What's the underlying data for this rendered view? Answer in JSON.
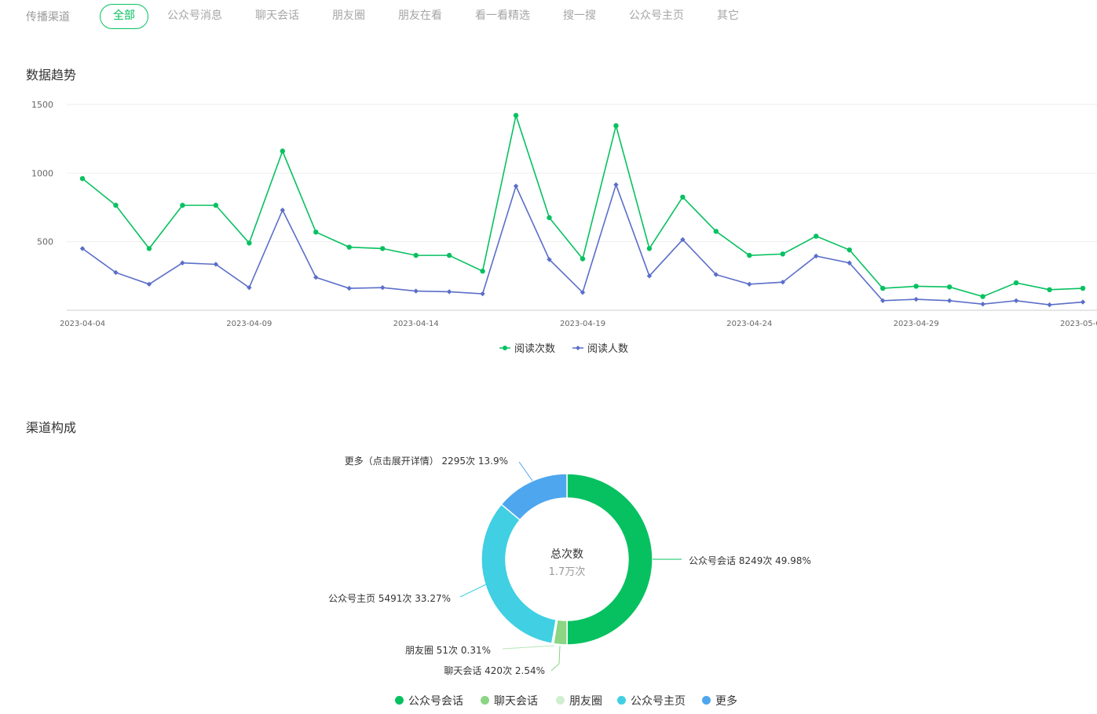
{
  "filter": {
    "label": "传播渠道",
    "tabs": [
      {
        "label": "全部",
        "active": true
      },
      {
        "label": "公众号消息",
        "active": false
      },
      {
        "label": "聊天会话",
        "active": false
      },
      {
        "label": "朋友圈",
        "active": false
      },
      {
        "label": "朋友在看",
        "active": false
      },
      {
        "label": "看一看精选",
        "active": false
      },
      {
        "label": "搜一搜",
        "active": false
      },
      {
        "label": "公众号主页",
        "active": false
      },
      {
        "label": "其它",
        "active": false
      }
    ]
  },
  "trend": {
    "title": "数据趋势"
  },
  "composition": {
    "title": "渠道构成"
  },
  "colors": {
    "accent": "#07c160",
    "reads": "#07c160",
    "readers": "#5b6ec9",
    "gongzhonghao_chat": "#07c160",
    "chat": "#8bd584",
    "moments": "#cfefcf",
    "homepage": "#40cfe3",
    "more": "#4da6ee"
  },
  "chart_data": [
    {
      "type": "line",
      "x": [
        "2023-04-04",
        "2023-04-05",
        "2023-04-06",
        "2023-04-07",
        "2023-04-08",
        "2023-04-09",
        "2023-04-10",
        "2023-04-11",
        "2023-04-12",
        "2023-04-13",
        "2023-04-14",
        "2023-04-15",
        "2023-04-16",
        "2023-04-17",
        "2023-04-18",
        "2023-04-19",
        "2023-04-20",
        "2023-04-21",
        "2023-04-22",
        "2023-04-23",
        "2023-04-24",
        "2023-04-25",
        "2023-04-26",
        "2023-04-27",
        "2023-04-28",
        "2023-04-29",
        "2023-04-30",
        "2023-05-01",
        "2023-05-02",
        "2023-05-03",
        "2023-05-04"
      ],
      "x_tick_labels": [
        "2023-04-04",
        "2023-04-09",
        "2023-04-14",
        "2023-04-19",
        "2023-04-24",
        "2023-04-29",
        "2023-05-04"
      ],
      "y_ticks": [
        500,
        1000,
        1500
      ],
      "ylim": [
        0,
        1500
      ],
      "legend_position": "bottom-center",
      "series": [
        {
          "name": "阅读次数",
          "marker": "circle",
          "values": [
            960,
            765,
            450,
            765,
            765,
            490,
            1160,
            570,
            460,
            450,
            400,
            400,
            285,
            1420,
            675,
            375,
            1345,
            450,
            825,
            575,
            400,
            410,
            540,
            440,
            160,
            175,
            170,
            100,
            200,
            150,
            160
          ]
        },
        {
          "name": "阅读人数",
          "marker": "diamond",
          "values": [
            450,
            275,
            190,
            345,
            335,
            165,
            730,
            240,
            160,
            165,
            140,
            135,
            120,
            905,
            370,
            130,
            915,
            250,
            515,
            260,
            190,
            205,
            395,
            345,
            70,
            80,
            70,
            45,
            70,
            40,
            60
          ]
        }
      ]
    },
    {
      "type": "pie",
      "variant": "donut",
      "center_title": "总次数",
      "center_value": "1.7万次",
      "slices": [
        {
          "name": "公众号会话",
          "value": 8249,
          "percent": 49.98,
          "label": "公众号会话 8249次 49.98%"
        },
        {
          "name": "聊天会话",
          "value": 420,
          "percent": 2.54,
          "label": "聊天会话 420次 2.54%"
        },
        {
          "name": "朋友圈",
          "value": 51,
          "percent": 0.31,
          "label": "朋友圈 51次 0.31%"
        },
        {
          "name": "公众号主页",
          "value": 5491,
          "percent": 33.27,
          "label": "公众号主页 5491次 33.27%"
        },
        {
          "name": "更多",
          "value": 2295,
          "percent": 13.9,
          "label": "更多（点击展开详情） 2295次 13.9%"
        }
      ],
      "legend": [
        "公众号会话",
        "聊天会话",
        "朋友圈",
        "公众号主页",
        "更多"
      ],
      "legend_position": "bottom-center"
    }
  ]
}
